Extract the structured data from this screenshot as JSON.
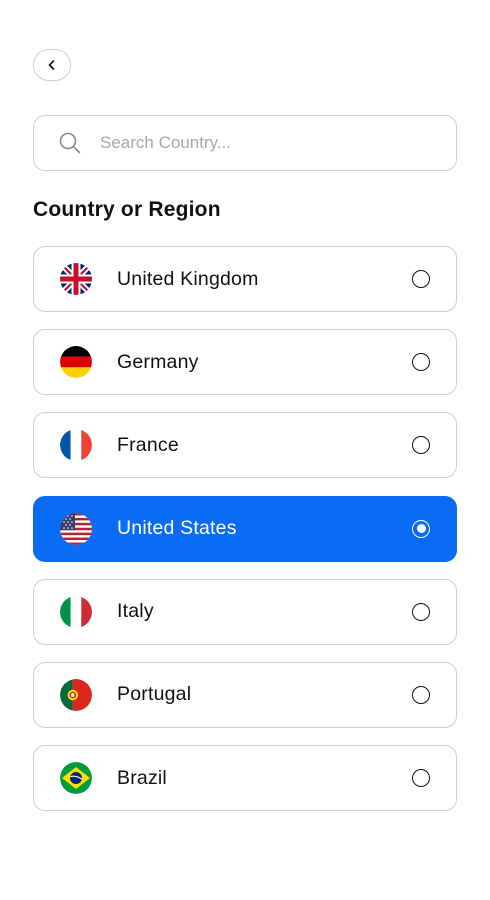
{
  "search": {
    "placeholder": "Search Country..."
  },
  "section": {
    "title": "Country or Region"
  },
  "countries": [
    {
      "name": "United Kingdom",
      "flag": "uk-flag-icon",
      "selected": false
    },
    {
      "name": "Germany",
      "flag": "germany-flag-icon",
      "selected": false
    },
    {
      "name": "France",
      "flag": "france-flag-icon",
      "selected": false
    },
    {
      "name": "United States",
      "flag": "usa-flag-icon",
      "selected": true
    },
    {
      "name": "Italy",
      "flag": "italy-flag-icon",
      "selected": false
    },
    {
      "name": "Portugal",
      "flag": "portugal-flag-icon",
      "selected": false
    },
    {
      "name": "Brazil",
      "flag": "brazil-flag-icon",
      "selected": false
    }
  ],
  "colors": {
    "accent": "#0a6cf5",
    "border": "#cfcfcf",
    "placeholder": "#a9a9a9"
  },
  "icons": {
    "back": "chevron-left-icon",
    "search": "search-icon"
  }
}
